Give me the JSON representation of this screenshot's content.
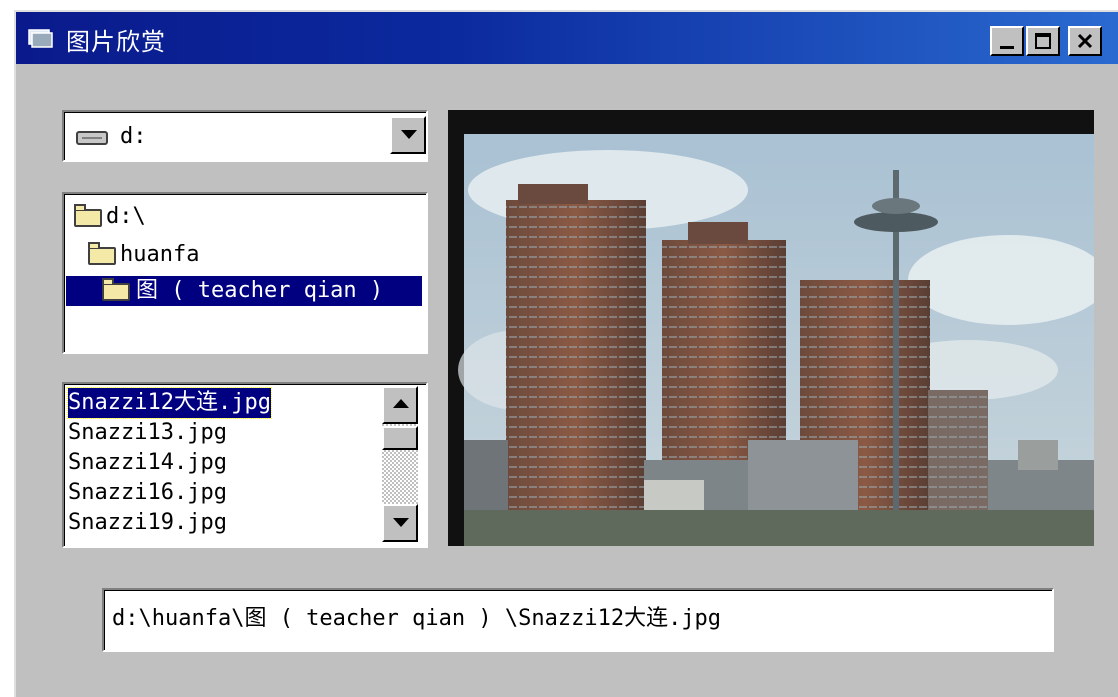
{
  "window": {
    "title": "图片欣赏"
  },
  "title_buttons": {
    "minimize": "_",
    "maximize": "□",
    "close": "×"
  },
  "drive_combo": {
    "value": "d:"
  },
  "dir_list": [
    {
      "label": "d:\\"
    },
    {
      "label": "huanfa"
    },
    {
      "label": "图 ( teacher qian )"
    }
  ],
  "file_list": [
    {
      "label": "Snazzi12大连.jpg"
    },
    {
      "label": "Snazzi13.jpg"
    },
    {
      "label": "Snazzi14.jpg"
    },
    {
      "label": "Snazzi16.jpg"
    },
    {
      "label": "Snazzi19.jpg"
    }
  ],
  "path_field": {
    "value": "d:\\huanfa\\图 ( teacher qian ) \\Snazzi12大连.jpg"
  },
  "colors": {
    "title_start": "#0a1a8c",
    "title_end": "#2a6ad0",
    "selection": "#000080",
    "face": "#c0c0c0"
  },
  "icons": [
    "app-icon",
    "drive-icon",
    "folder-open-icon",
    "chevron-down-icon",
    "scroll-up-icon",
    "scroll-down-icon"
  ]
}
